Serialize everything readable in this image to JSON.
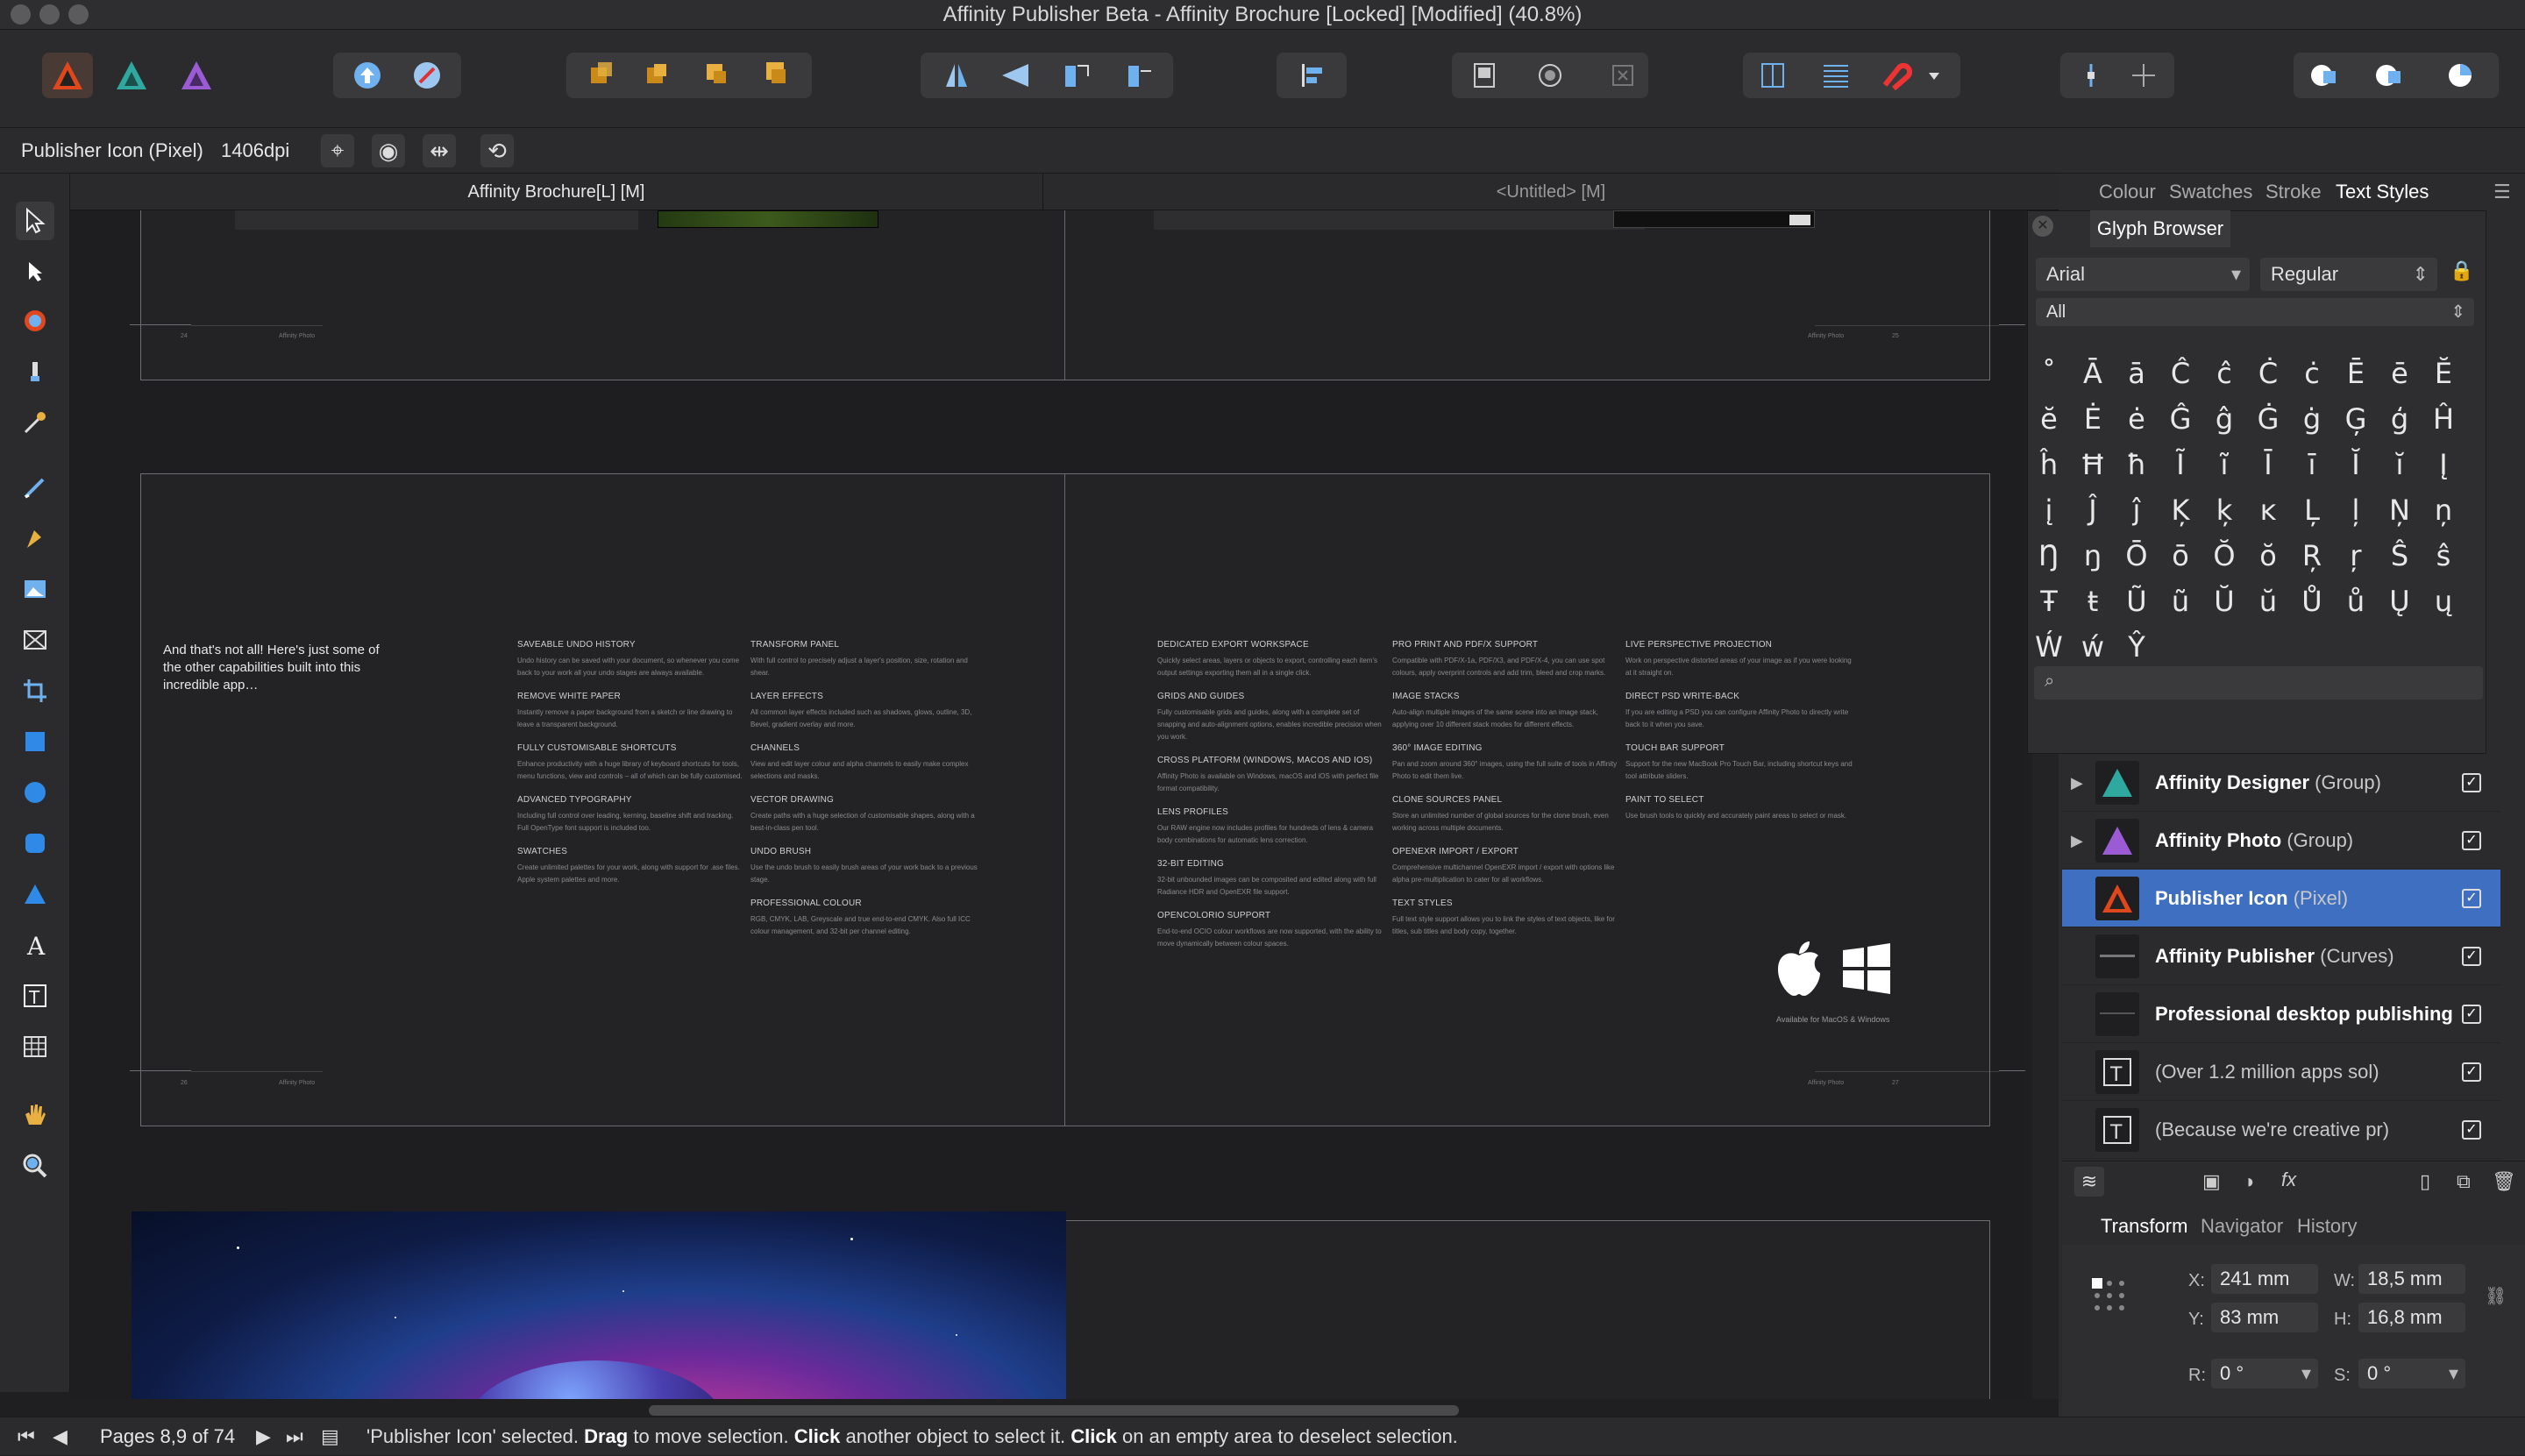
{
  "window": {
    "title": "Affinity Publisher Beta - Affinity Brochure [Locked] [Modified] (40.8%)"
  },
  "context_toolbar": {
    "selection_label": "Publisher Icon (Pixel)",
    "dpi": "1406dpi"
  },
  "doc_tabs": [
    {
      "label": "Affinity Brochure[L] [M]"
    },
    {
      "label": "<Untitled> [M]"
    }
  ],
  "page_content": {
    "intro": "And that's not all! Here's just some of the other capabilities built into this incredible app…",
    "left_col1": [
      {
        "h": "SAVEABLE UNDO HISTORY",
        "b": "Undo history can be saved with your document, so whenever you come back to your work all your undo stages are always available."
      },
      {
        "h": "REMOVE WHITE PAPER",
        "b": "Instantly remove a paper background from a sketch or line drawing to leave a transparent background."
      },
      {
        "h": "FULLY CUSTOMISABLE SHORTCUTS",
        "b": "Enhance productivity with a huge library of keyboard shortcuts for tools, menu functions, view and controls – all of which can be fully customised."
      },
      {
        "h": "ADVANCED TYPOGRAPHY",
        "b": "Including full control over leading, kerning, baseline shift and tracking. Full OpenType font support is included too."
      },
      {
        "h": "SWATCHES",
        "b": "Create unlimited palettes for your work, along with support for .ase files. Apple system palettes and more."
      }
    ],
    "left_col2": [
      {
        "h": "TRANSFORM PANEL",
        "b": "With full control to precisely adjust a layer's position, size, rotation and shear."
      },
      {
        "h": "LAYER EFFECTS",
        "b": "All common layer effects included such as shadows, glows, outline, 3D, Bevel, gradient overlay and more."
      },
      {
        "h": "CHANNELS",
        "b": "View and edit layer colour and alpha channels to easily make complex selections and masks."
      },
      {
        "h": "VECTOR DRAWING",
        "b": "Create paths with a huge selection of customisable shapes, along with a best-in-class pen tool."
      },
      {
        "h": "UNDO BRUSH",
        "b": "Use the undo brush to easily brush areas of your work back to a previous stage."
      },
      {
        "h": "PROFESSIONAL COLOUR",
        "b": "RGB, CMYK, LAB, Greyscale and true end-to-end CMYK. Also full ICC colour management, and 32-bit per channel editing."
      }
    ],
    "right_col1": [
      {
        "h": "DEDICATED EXPORT WORKSPACE",
        "b": "Quickly select areas, layers or objects to export, controlling each item's output settings exporting them all in a single click."
      },
      {
        "h": "GRIDS AND GUIDES",
        "b": "Fully customisable grids and guides, along with a complete set of snapping and auto-alignment options, enables incredible precision when you work."
      },
      {
        "h": "CROSS PLATFORM (WINDOWS, MACOS AND IOS)",
        "b": "Affinity Photo is available on Windows, macOS and iOS with perfect file format compatibility."
      },
      {
        "h": "LENS PROFILES",
        "b": "Our RAW engine now includes profiles for hundreds of lens & camera body combinations for automatic lens correction."
      },
      {
        "h": "32-BIT EDITING",
        "b": "32-bit unbounded images can be composited and edited along with full Radiance HDR and OpenEXR file support."
      },
      {
        "h": "OPENCOLORIO SUPPORT",
        "b": "End-to-end OCIO colour workflows are now supported, with the ability to move dynamically between colour spaces."
      }
    ],
    "right_col2": [
      {
        "h": "PRO PRINT AND PDF/X SUPPORT",
        "b": "Compatible with PDF/X-1a, PDF/X3, and PDF/X-4, you can use spot colours, apply overprint controls and add trim, bleed and crop marks."
      },
      {
        "h": "IMAGE STACKS",
        "b": "Auto-align multiple images of the same scene into an image stack, applying over 10 different stack modes for different effects."
      },
      {
        "h": "360° IMAGE EDITING",
        "b": "Pan and zoom around 360° images, using the full suite of tools in Affinity Photo to edit them live."
      },
      {
        "h": "CLONE SOURCES PANEL",
        "b": "Store an unlimited number of global sources for the clone brush, even working across multiple documents."
      },
      {
        "h": "OPENEXR IMPORT / EXPORT",
        "b": "Comprehensive multichannel OpenEXR import / export with options like alpha pre-multiplication to cater for all workflows."
      },
      {
        "h": "TEXT STYLES",
        "b": "Full text style support allows you to link the styles of text objects, like for titles, sub titles and body copy, together."
      }
    ],
    "right_col3": [
      {
        "h": "LIVE PERSPECTIVE PROJECTION",
        "b": "Work on perspective distorted areas of your image as if you were looking at it straight on."
      },
      {
        "h": "DIRECT PSD WRITE-BACK",
        "b": "If you are editing a PSD you can configure Affinity Photo to directly write back to it when you save."
      },
      {
        "h": "TOUCH BAR SUPPORT",
        "b": "Support for the new MacBook Pro Touch Bar, including shortcut keys and tool attribute sliders."
      },
      {
        "h": "PAINT TO SELECT",
        "b": "Use brush tools to quickly and accurately paint areas to select or mask."
      }
    ],
    "availability": "Available for MacOS & Windows",
    "folio_text": "Affinity Photo",
    "page_numbers": [
      "24",
      "25",
      "26",
      "27"
    ]
  },
  "panel_tabs_top": [
    {
      "label": "Colour"
    },
    {
      "label": "Swatches"
    },
    {
      "label": "Stroke"
    },
    {
      "label": "Text Styles"
    }
  ],
  "glyph_browser": {
    "title": "Glyph Browser",
    "font": "Arial",
    "style": "Regular",
    "subset": "All",
    "glyphs": [
      "˚",
      "Ā",
      "ā",
      "Ĉ",
      "ĉ",
      "Ċ",
      "ċ",
      "Ē",
      "ē",
      "Ĕ",
      "ĕ",
      "Ė",
      "ė",
      "Ĝ",
      "ĝ",
      "Ġ",
      "ġ",
      "Ģ",
      "ģ",
      "Ĥ",
      "ĥ",
      "Ħ",
      "ħ",
      "Ĩ",
      "ĩ",
      "Ī",
      "ī",
      "Ĭ",
      "ĭ",
      "Į",
      "į",
      "Ĵ",
      "ĵ",
      "Ķ",
      "ķ",
      "ĸ",
      "Ļ",
      "ļ",
      "Ņ",
      "ņ",
      "Ŋ",
      "ŋ",
      "Ō",
      "ō",
      "Ŏ",
      "ŏ",
      "Ŗ",
      "ŗ",
      "Ŝ",
      "ŝ",
      "Ŧ",
      "ŧ",
      "Ũ",
      "ũ",
      "Ŭ",
      "ŭ",
      "Ů",
      "ů",
      "Ų",
      "ų",
      "Ẃ",
      "ẃ",
      "Ŷ"
    ]
  },
  "layers": [
    {
      "name": "Affinity Designer",
      "type": "(Group)",
      "checked": "✓"
    },
    {
      "name": "Affinity Photo",
      "type": "(Group)",
      "checked": "✓"
    },
    {
      "name": "Publisher Icon",
      "type": "(Pixel)",
      "checked": "✓"
    },
    {
      "name": "Affinity Publisher",
      "type": "(Curves)",
      "checked": "✓"
    },
    {
      "name": "Professional desktop publishing",
      "type": "",
      "checked": "✓"
    },
    {
      "name": "",
      "type": "(Over 1.2 million apps sol)",
      "checked": "✓"
    },
    {
      "name": "",
      "type": "(Because we're creative pr)",
      "checked": "✓"
    }
  ],
  "panel_tabs_bottom": [
    {
      "label": "Transform"
    },
    {
      "label": "Navigator"
    },
    {
      "label": "History"
    }
  ],
  "transform": {
    "x_label": "X:",
    "x": "241 mm",
    "y_label": "Y:",
    "y": "83 mm",
    "w_label": "W:",
    "w": "18,5 mm",
    "h_label": "H:",
    "h": "16,8 mm",
    "r_label": "R:",
    "r": "0 °",
    "s_label": "S:",
    "s": "0 °"
  },
  "status": {
    "pages": "Pages 8,9 of 74",
    "message_prefix": "'Publisher Icon' selected. ",
    "drag": "Drag",
    "m1": " to move selection. ",
    "click1": "Click",
    "m2": " another object to select it. ",
    "click2": "Click",
    "m3": " on an empty area to deselect selection."
  },
  "colors": {
    "accent_selection": "#3e6fc1",
    "publisher_orange": "#e0471d",
    "designer_teal": "#2fa8a0",
    "photo_purple": "#9b5bd4"
  }
}
